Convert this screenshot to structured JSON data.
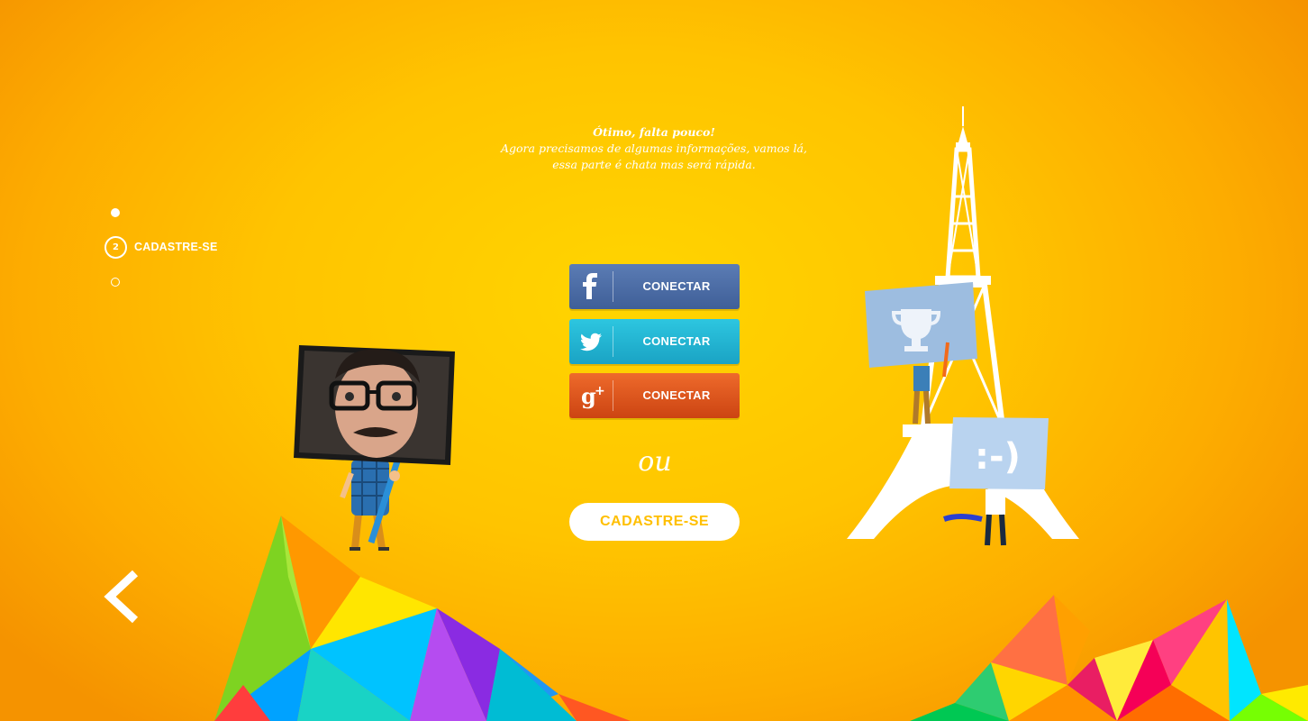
{
  "header": {
    "title": "Ótimo, falta pouco!",
    "line1": "Agora precisamos de algumas informações, vamos lá,",
    "line2": "essa parte é chata mas será rápida."
  },
  "steps": {
    "current_number": "2",
    "current_label": "CADASTRE-SE"
  },
  "social": {
    "facebook_label": "CONECTAR",
    "twitter_label": "CONECTAR",
    "googleplus_label": "CONECTAR"
  },
  "or_text": "ou",
  "register_label": "CADASTRE-SE",
  "colors": {
    "background": "#ffc400",
    "facebook": "#4a6aa4",
    "twitter": "#22b4d2",
    "googleplus": "#dd541c",
    "register_text": "#ffbf00"
  },
  "icons": [
    "facebook-icon",
    "twitter-icon",
    "google-plus-icon",
    "back-arrow-icon",
    "trophy-icon"
  ]
}
